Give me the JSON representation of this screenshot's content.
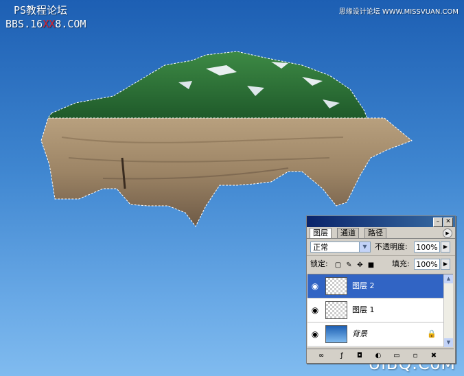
{
  "watermarks": {
    "site_title": "PS教程论坛",
    "bbs_prefix": "BBS.16",
    "bbs_highlight": "XX",
    "bbs_suffix": "8.COM",
    "top_right": "思缘设计论坛 WWW.MISSVUAN.COM",
    "bottom_right": "UiBQ.CoM"
  },
  "canvas": {
    "island_icon": "floating-island-image",
    "colors": {
      "sky_top": "#1d5fb3",
      "sky_bottom": "#80bbef"
    }
  },
  "layers_panel": {
    "tabs": [
      {
        "label": "图层",
        "active": true
      },
      {
        "label": "通道",
        "active": false
      },
      {
        "label": "路径",
        "active": false
      }
    ],
    "blend_mode": "正常",
    "opacity_label": "不透明度:",
    "opacity_value": "100%",
    "lock_label": "锁定:",
    "fill_label": "填充:",
    "fill_value": "100%",
    "layers": [
      {
        "name": "图层 2",
        "selected": true,
        "visible": true
      },
      {
        "name": "图层 1",
        "selected": false,
        "visible": true
      },
      {
        "name": "背景",
        "selected": false,
        "visible": true,
        "locked": true
      }
    ],
    "colors": {
      "selection": "#3164c4",
      "title_bar": "#0a246a"
    }
  }
}
